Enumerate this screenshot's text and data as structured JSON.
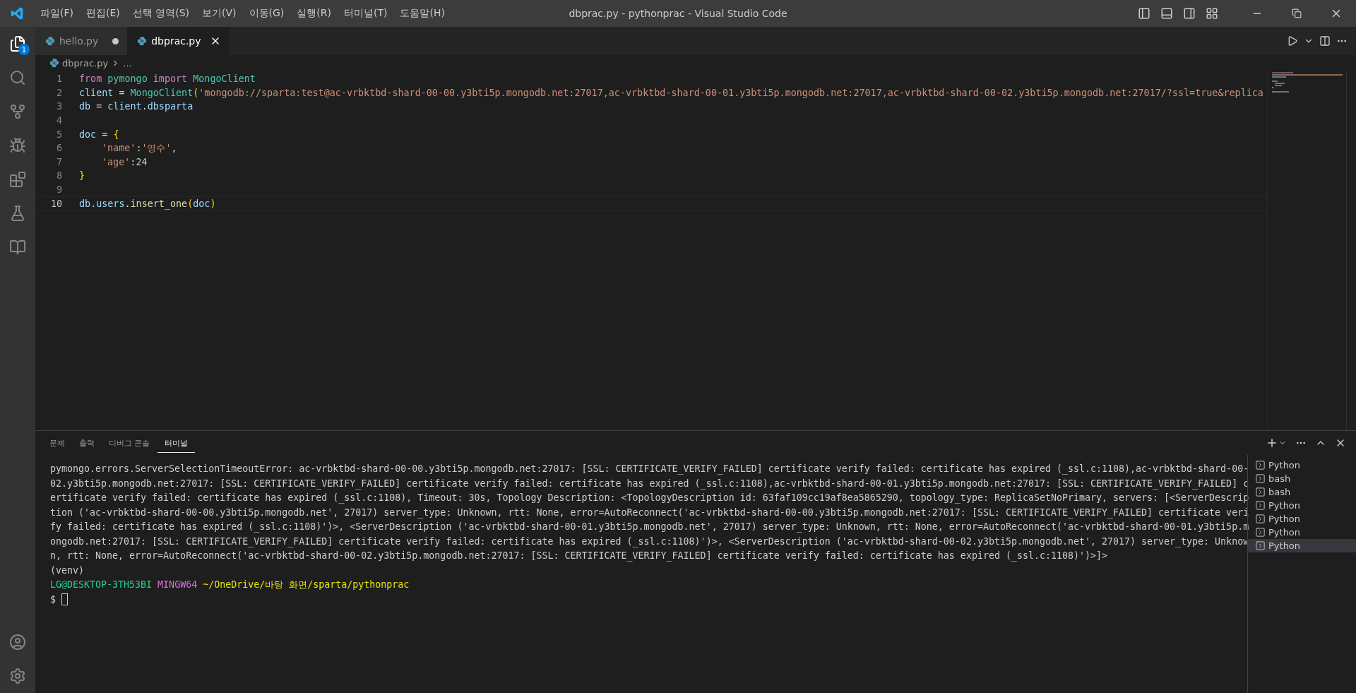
{
  "menu": [
    "파일(F)",
    "편집(E)",
    "선택 영역(S)",
    "보기(V)",
    "이동(G)",
    "실행(R)",
    "터미널(T)",
    "도움말(H)"
  ],
  "window": {
    "title": "dbprac.py - pythonprac - Visual Studio Code"
  },
  "activity": {
    "explorer_badge": "1"
  },
  "tabs": [
    {
      "label": "hello.py",
      "selected": false,
      "modified": true
    },
    {
      "label": "dbprac.py",
      "selected": true,
      "modified": false
    }
  ],
  "breadcrumb": [
    "dbprac.py",
    "..."
  ],
  "code": [
    {
      "number": "1",
      "current": false,
      "tokens": [
        {
          "text": "from ",
          "kind": "keyword"
        },
        {
          "text": "pymongo ",
          "kind": "type"
        },
        {
          "text": "import ",
          "kind": "keyword"
        },
        {
          "text": "MongoClient",
          "kind": "type"
        }
      ]
    },
    {
      "number": "2",
      "current": false,
      "tokens": [
        {
          "text": "client",
          "kind": "var"
        },
        {
          "text": " = ",
          "kind": "plain"
        },
        {
          "text": "MongoClient",
          "kind": "type"
        },
        {
          "text": "(",
          "kind": "bracket"
        },
        {
          "text": "'mongodb://sparta:test@ac-vrbktbd-shard-00-00.y3bti5p.mongodb.net:27017,ac-vrbktbd-shard-00-01.y3bti5p.mongodb.net:27017,ac-vrbktbd-shard-00-02.y3bti5p.mongodb.net:27017/?ssl=true&replica",
          "kind": "string"
        }
      ]
    },
    {
      "number": "3",
      "current": false,
      "tokens": [
        {
          "text": "db",
          "kind": "var"
        },
        {
          "text": " = ",
          "kind": "plain"
        },
        {
          "text": "client",
          "kind": "var"
        },
        {
          "text": ".",
          "kind": "plain"
        },
        {
          "text": "dbsparta",
          "kind": "var"
        }
      ]
    },
    {
      "number": "4",
      "current": false
    },
    {
      "number": "5",
      "current": false,
      "tokens": [
        {
          "text": "doc",
          "kind": "var"
        },
        {
          "text": " = ",
          "kind": "plain"
        },
        {
          "text": "{",
          "kind": "bracket"
        }
      ]
    },
    {
      "number": "6",
      "current": false,
      "indented": true,
      "tokens": [
        {
          "text": "'name'",
          "kind": "string"
        },
        {
          "text": ":",
          "kind": "plain"
        },
        {
          "text": "'영수'",
          "kind": "string"
        },
        {
          "text": ",",
          "kind": "plain"
        }
      ]
    },
    {
      "number": "7",
      "current": false,
      "indented": true,
      "tokens": [
        {
          "text": "'age'",
          "kind": "string"
        },
        {
          "text": ":",
          "kind": "plain"
        },
        {
          "text": "24",
          "kind": "number"
        }
      ]
    },
    {
      "number": "8",
      "current": false,
      "tokens": [
        {
          "text": "}",
          "kind": "bracket"
        }
      ]
    },
    {
      "number": "9",
      "current": false
    },
    {
      "number": "10",
      "current": true,
      "tokens": [
        {
          "text": "db",
          "kind": "var"
        },
        {
          "text": ".",
          "kind": "plain"
        },
        {
          "text": "users",
          "kind": "var"
        },
        {
          "text": ".",
          "kind": "plain"
        },
        {
          "text": "insert_one",
          "kind": "func"
        },
        {
          "text": "(",
          "kind": "bracket"
        },
        {
          "text": "doc",
          "kind": "var"
        },
        {
          "text": ")",
          "kind": "bracket"
        }
      ]
    }
  ],
  "panel_tabs": [
    {
      "label": "문제",
      "selected": false
    },
    {
      "label": "출력",
      "selected": false
    },
    {
      "label": "디버그 콘솔",
      "selected": false
    },
    {
      "label": "터미널",
      "selected": true
    }
  ],
  "terminal": {
    "error": "pymongo.errors.ServerSelectionTimeoutError: ac-vrbktbd-shard-00-00.y3bti5p.mongodb.net:27017: [SSL: CERTIFICATE_VERIFY_FAILED] certificate verify failed: certificate has expired (_ssl.c:1108),ac-vrbktbd-shard-00-02.y3bti5p.mongodb.net:27017: [SSL: CERTIFICATE_VERIFY_FAILED] certificate verify failed: certificate has expired (_ssl.c:1108),ac-vrbktbd-shard-00-01.y3bti5p.mongodb.net:27017: [SSL: CERTIFICATE_VERIFY_FAILED] certificate verify failed: certificate has expired (_ssl.c:1108), Timeout: 30s, Topology Description: <TopologyDescription id: 63faf109cc19af8ea5865290, topology_type: ReplicaSetNoPrimary, servers: [<ServerDescription ('ac-vrbktbd-shard-00-00.y3bti5p.mongodb.net', 27017) server_type: Unknown, rtt: None, error=AutoReconnect('ac-vrbktbd-shard-00-00.y3bti5p.mongodb.net:27017: [SSL: CERTIFICATE_VERIFY_FAILED] certificate verify failed: certificate has expired (_ssl.c:1108)')>, <ServerDescription ('ac-vrbktbd-shard-00-01.y3bti5p.mongodb.net', 27017) server_type: Unknown, rtt: None, error=AutoReconnect('ac-vrbktbd-shard-00-01.y3bti5p.mongodb.net:27017: [SSL: CERTIFICATE_VERIFY_FAILED] certificate verify failed: certificate has expired (_ssl.c:1108)')>, <ServerDescription ('ac-vrbktbd-shard-00-02.y3bti5p.mongodb.net', 27017) server_type: Unknown, rtt: None, error=AutoReconnect('ac-vrbktbd-shard-00-02.y3bti5p.mongodb.net:27017: [SSL: CERTIFICATE_VERIFY_FAILED] certificate verify failed: certificate has expired (_ssl.c:1108)')>]>",
    "venv": "(venv)",
    "prompt": [
      {
        "text": "LG@DESKTOP-3TH53BI",
        "kind": "user"
      },
      {
        "text": "MINGW64",
        "kind": "shell"
      },
      {
        "text": "~/OneDrive/바탕 화면/sparta/pythonprac",
        "kind": "path"
      }
    ],
    "symbol": "$"
  },
  "terminals": [
    {
      "label": "Python",
      "selected": false
    },
    {
      "label": "bash",
      "selected": false
    },
    {
      "label": "bash",
      "selected": false
    },
    {
      "label": "Python",
      "selected": false
    },
    {
      "label": "Python",
      "selected": false
    },
    {
      "label": "Python",
      "selected": false
    },
    {
      "label": "Python",
      "selected": true
    }
  ]
}
